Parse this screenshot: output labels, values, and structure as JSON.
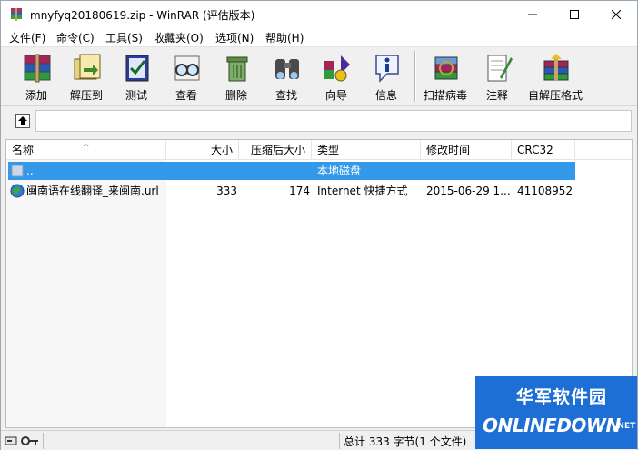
{
  "window": {
    "title": "mnyfyq20180619.zip - WinRAR (评估版本)"
  },
  "menu": [
    {
      "label": "文件(F)"
    },
    {
      "label": "命令(C)"
    },
    {
      "label": "工具(S)"
    },
    {
      "label": "收藏夹(O)"
    },
    {
      "label": "选项(N)"
    },
    {
      "label": "帮助(H)"
    }
  ],
  "toolbar": [
    {
      "label": "添加",
      "icon": "add-books-icon"
    },
    {
      "label": "解压到",
      "icon": "extract-to-icon"
    },
    {
      "label": "测试",
      "icon": "test-icon"
    },
    {
      "label": "查看",
      "icon": "view-glasses-icon"
    },
    {
      "label": "删除",
      "icon": "delete-icon"
    },
    {
      "label": "查找",
      "icon": "find-binoculars-icon"
    },
    {
      "label": "向导",
      "icon": "wizard-icon"
    },
    {
      "label": "信息",
      "icon": "info-icon"
    },
    {
      "label": "扫描病毒",
      "icon": "scan-virus-icon"
    },
    {
      "label": "注释",
      "icon": "comment-icon"
    },
    {
      "label": "自解压格式",
      "icon": "sfx-icon"
    }
  ],
  "address": {
    "value": ""
  },
  "list": {
    "columns": [
      "名称",
      "大小",
      "压缩后大小",
      "类型",
      "修改时间",
      "CRC32"
    ],
    "rows": [
      {
        "name": "..",
        "size": "",
        "packed": "",
        "type": "本地磁盘",
        "modified": "",
        "crc": "",
        "selected": true
      },
      {
        "name": "闽南语在线翻译_来闽南.url",
        "size": "333",
        "packed": "174",
        "type": "Internet 快捷方式",
        "modified": "2015-06-29 1...",
        "crc": "41108952",
        "selected": false
      }
    ]
  },
  "status": {
    "text": "总计 333 字节(1 个文件)"
  },
  "watermark": {
    "cn": "华军软件园",
    "en": "ONLINEDOWN",
    "suffix": ".NET"
  },
  "colors": {
    "selection": "#3399e8",
    "watermark_bg": "#1d6fd6"
  }
}
